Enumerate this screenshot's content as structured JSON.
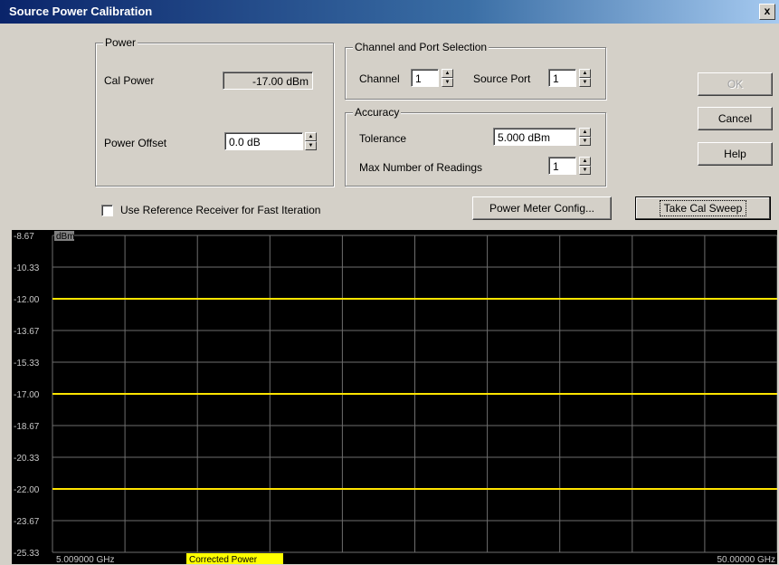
{
  "window": {
    "title": "Source Power Calibration",
    "close_label": "x"
  },
  "power": {
    "legend": "Power",
    "cal_power_label": "Cal Power",
    "cal_power_value": "-17.00 dBm",
    "offset_label": "Power Offset",
    "offset_value": "0.0 dB"
  },
  "channel_port": {
    "legend": "Channel and Port Selection",
    "channel_label": "Channel",
    "channel_value": "1",
    "source_port_label": "Source Port",
    "source_port_value": "1"
  },
  "accuracy": {
    "legend": "Accuracy",
    "tolerance_label": "Tolerance",
    "tolerance_value": "5.000 dBm",
    "max_readings_label": "Max Number of Readings",
    "max_readings_value": "1"
  },
  "buttons": {
    "ok": "OK",
    "cancel": "Cancel",
    "help": "Help",
    "power_meter_config": "Power Meter Config...",
    "take_cal_sweep": "Take Cal Sweep"
  },
  "use_reference_label": "Use Reference Receiver for Fast Iteration",
  "use_reference_checked": false,
  "chart_data": {
    "type": "line",
    "unit_label": "dBm",
    "y_ticks": [
      "-8.67",
      "-10.33",
      "-12.00",
      "-13.67",
      "-15.33",
      "-17.00",
      "-18.67",
      "-20.33",
      "-22.00",
      "-23.67",
      "-25.33"
    ],
    "ylim": [
      -25.33,
      -8.67
    ],
    "xlim": [
      5.009,
      50.0
    ],
    "x_start_label": "5.009000 GHz",
    "x_stop_label": "50.00000 GHz",
    "x_divisions": 10,
    "grid": true,
    "series": [
      {
        "name": "",
        "y": -12.0
      },
      {
        "name": "",
        "y": -17.0
      },
      {
        "name": "",
        "y": -22.0
      }
    ],
    "marker_label": "Corrected Power",
    "colors": {
      "background": "#000000",
      "grid": "#6e6e6e",
      "trace": "#ffe400",
      "tick_text": "#c8c8c8",
      "unit_badge": "#808080",
      "marker_bg": "#ffff00"
    }
  }
}
